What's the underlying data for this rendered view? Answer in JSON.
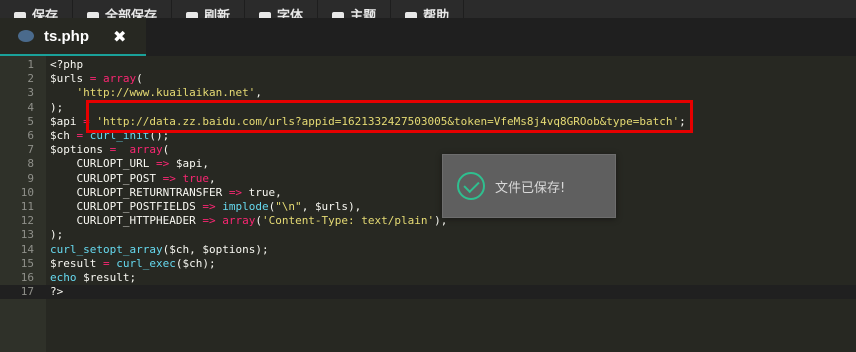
{
  "toolbar": {
    "items": [
      {
        "label": "保存",
        "icon": "save-icon"
      },
      {
        "label": "全部保存",
        "icon": "save-all-icon"
      },
      {
        "label": "刷新",
        "icon": "refresh-icon"
      },
      {
        "label": "字体",
        "icon": "font-icon"
      },
      {
        "label": "主题",
        "icon": "theme-icon"
      },
      {
        "label": "帮助",
        "icon": "help-icon"
      }
    ]
  },
  "tab": {
    "name": "ts.php",
    "close": "✖"
  },
  "toast": {
    "message": "文件已保存!"
  },
  "colors": {
    "accent": "#1aa19a",
    "highlight": "#e60000",
    "keyword": "#f92672",
    "string": "#e6db74",
    "function": "#66d9ef"
  },
  "code": {
    "lines": [
      {
        "n": "1",
        "segs": [
          [
            "t",
            "<?php"
          ]
        ]
      },
      {
        "n": "2",
        "segs": [
          [
            "v",
            "$urls"
          ],
          [
            "k",
            " = "
          ],
          [
            "k",
            "array"
          ],
          [
            "t",
            "("
          ]
        ]
      },
      {
        "n": "3",
        "segs": [
          [
            "t",
            "    "
          ],
          [
            "s",
            "'http://www.kuailaikan.net'"
          ],
          [
            "t",
            ","
          ]
        ]
      },
      {
        "n": "4",
        "segs": [
          [
            "t",
            ");"
          ]
        ]
      },
      {
        "n": "5",
        "segs": [
          [
            "v",
            "$api"
          ],
          [
            "k",
            " = "
          ],
          [
            "s",
            "'http://data.zz.baidu.com/urls?appid=1621332427503005&token=VfeMs8j4vq8GROob&type=batch'"
          ],
          [
            "t",
            ";"
          ]
        ]
      },
      {
        "n": "6",
        "segs": [
          [
            "v",
            "$ch"
          ],
          [
            "k",
            " = "
          ],
          [
            "f",
            "curl_init"
          ],
          [
            "t",
            "();"
          ]
        ]
      },
      {
        "n": "7",
        "segs": [
          [
            "v",
            "$options"
          ],
          [
            "k",
            " =  "
          ],
          [
            "k",
            "array"
          ],
          [
            "t",
            "("
          ]
        ]
      },
      {
        "n": "8",
        "segs": [
          [
            "t",
            "    CURLOPT_URL "
          ],
          [
            "k",
            "=>"
          ],
          [
            "t",
            " "
          ],
          [
            "v",
            "$api"
          ],
          [
            "t",
            ","
          ]
        ]
      },
      {
        "n": "9",
        "segs": [
          [
            "t",
            "    CURLOPT_POST "
          ],
          [
            "k",
            "=>"
          ],
          [
            "t",
            " "
          ],
          [
            "k",
            "true"
          ],
          [
            "t",
            ","
          ]
        ]
      },
      {
        "n": "10",
        "segs": [
          [
            "t",
            "    CURLOPT_RETURNTRANSFER "
          ],
          [
            "k",
            "=>"
          ],
          [
            "t",
            " true,"
          ]
        ]
      },
      {
        "n": "11",
        "segs": [
          [
            "t",
            "    CURLOPT_POSTFIELDS "
          ],
          [
            "k",
            "=>"
          ],
          [
            "t",
            " "
          ],
          [
            "f",
            "implode"
          ],
          [
            "t",
            "("
          ],
          [
            "s",
            "\"\\n\""
          ],
          [
            "t",
            ", "
          ],
          [
            "v",
            "$urls"
          ],
          [
            "t",
            "),"
          ]
        ]
      },
      {
        "n": "12",
        "segs": [
          [
            "t",
            "    CURLOPT_HTTPHEADER "
          ],
          [
            "k",
            "=>"
          ],
          [
            "t",
            " "
          ],
          [
            "k",
            "array"
          ],
          [
            "t",
            "("
          ],
          [
            "s",
            "'Content-Type: text/plain'"
          ],
          [
            "t",
            "),"
          ]
        ]
      },
      {
        "n": "13",
        "segs": [
          [
            "t",
            ");"
          ]
        ]
      },
      {
        "n": "14",
        "segs": [
          [
            "f",
            "curl_setopt_array"
          ],
          [
            "t",
            "("
          ],
          [
            "v",
            "$ch"
          ],
          [
            "t",
            ", "
          ],
          [
            "v",
            "$options"
          ],
          [
            "t",
            ");"
          ]
        ]
      },
      {
        "n": "15",
        "segs": [
          [
            "v",
            "$result"
          ],
          [
            "k",
            " = "
          ],
          [
            "f",
            "curl_exec"
          ],
          [
            "t",
            "("
          ],
          [
            "v",
            "$ch"
          ],
          [
            "t",
            ");"
          ]
        ]
      },
      {
        "n": "16",
        "segs": [
          [
            "f",
            "echo"
          ],
          [
            "t",
            " "
          ],
          [
            "v",
            "$result"
          ],
          [
            "t",
            ";"
          ]
        ]
      },
      {
        "n": "17",
        "segs": [
          [
            "t",
            "?>"
          ]
        ]
      }
    ]
  }
}
